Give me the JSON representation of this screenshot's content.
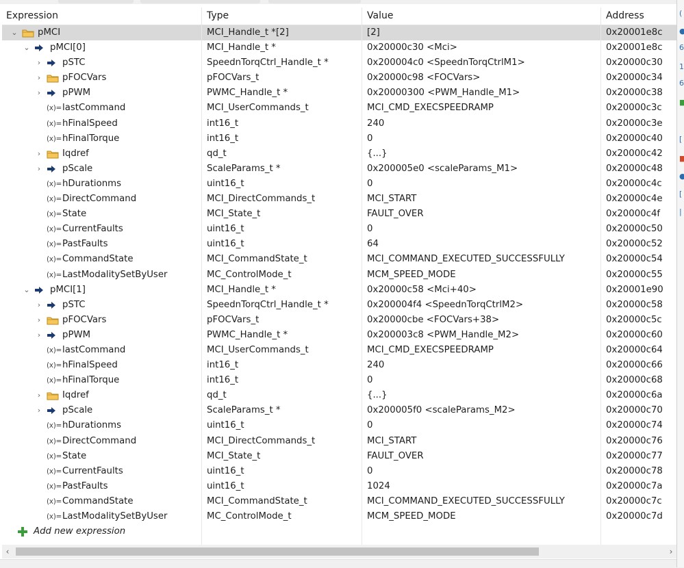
{
  "columns": {
    "expression": "Expression",
    "type": "Type",
    "value": "Value",
    "address": "Address"
  },
  "rows": [
    {
      "name": "pMCI",
      "type": "MCI_Handle_t *[2]",
      "value": "[2]",
      "addr": "0x20001e8c",
      "icon": "folder-struct-icon",
      "level": 0,
      "chevron": "expanded",
      "selected": true
    },
    {
      "name": "pMCI[0]",
      "type": "MCI_Handle_t *",
      "value": "0x20000c30 <Mci>",
      "addr": "0x20001e8c",
      "icon": "pointer-arrow-icon",
      "level": 1,
      "chevron": "expanded"
    },
    {
      "name": "pSTC",
      "type": "SpeednTorqCtrl_Handle_t *",
      "value": "0x200004c0 <SpeednTorqCtrlM1>",
      "addr": "0x20000c30",
      "icon": "pointer-arrow-icon",
      "level": 2,
      "chevron": "collapsed"
    },
    {
      "name": "pFOCVars",
      "type": "pFOCVars_t",
      "value": "0x20000c98 <FOCVars>",
      "addr": "0x20000c34",
      "icon": "folder-struct-icon",
      "level": 2,
      "chevron": "collapsed"
    },
    {
      "name": "pPWM",
      "type": "PWMC_Handle_t *",
      "value": "0x20000300 <PWM_Handle_M1>",
      "addr": "0x20000c38",
      "icon": "pointer-arrow-icon",
      "level": 2,
      "chevron": "collapsed"
    },
    {
      "name": "lastCommand",
      "type": "MCI_UserCommands_t",
      "value": "MCI_CMD_EXECSPEEDRAMP",
      "addr": "0x20000c3c",
      "icon": "variable-icon",
      "level": 2,
      "chevron": "none"
    },
    {
      "name": "hFinalSpeed",
      "type": "int16_t",
      "value": "240",
      "addr": "0x20000c3e",
      "icon": "variable-icon",
      "level": 2,
      "chevron": "none"
    },
    {
      "name": "hFinalTorque",
      "type": "int16_t",
      "value": "0",
      "addr": "0x20000c40",
      "icon": "variable-icon",
      "level": 2,
      "chevron": "none"
    },
    {
      "name": "Iqdref",
      "type": "qd_t",
      "value": "{...}",
      "addr": "0x20000c42",
      "icon": "folder-struct-icon",
      "level": 2,
      "chevron": "collapsed"
    },
    {
      "name": "pScale",
      "type": "ScaleParams_t *",
      "value": "0x200005e0 <scaleParams_M1>",
      "addr": "0x20000c48",
      "icon": "pointer-arrow-icon",
      "level": 2,
      "chevron": "collapsed"
    },
    {
      "name": "hDurationms",
      "type": "uint16_t",
      "value": "0",
      "addr": "0x20000c4c",
      "icon": "variable-icon",
      "level": 2,
      "chevron": "none"
    },
    {
      "name": "DirectCommand",
      "type": "MCI_DirectCommands_t",
      "value": "MCI_START",
      "addr": "0x20000c4e",
      "icon": "variable-icon",
      "level": 2,
      "chevron": "none"
    },
    {
      "name": "State",
      "type": "MCI_State_t",
      "value": "FAULT_OVER",
      "addr": "0x20000c4f",
      "icon": "variable-icon",
      "level": 2,
      "chevron": "none"
    },
    {
      "name": "CurrentFaults",
      "type": "uint16_t",
      "value": "0",
      "addr": "0x20000c50",
      "icon": "variable-icon",
      "level": 2,
      "chevron": "none"
    },
    {
      "name": "PastFaults",
      "type": "uint16_t",
      "value": "64",
      "addr": "0x20000c52",
      "icon": "variable-icon",
      "level": 2,
      "chevron": "none"
    },
    {
      "name": "CommandState",
      "type": "MCI_CommandState_t",
      "value": "MCI_COMMAND_EXECUTED_SUCCESSFULLY",
      "addr": "0x20000c54",
      "icon": "variable-icon",
      "level": 2,
      "chevron": "none"
    },
    {
      "name": "LastModalitySetByUser",
      "type": "MC_ControlMode_t",
      "value": "MCM_SPEED_MODE",
      "addr": "0x20000c55",
      "icon": "variable-icon",
      "level": 2,
      "chevron": "none"
    },
    {
      "name": "pMCI[1]",
      "type": "MCI_Handle_t *",
      "value": "0x20000c58 <Mci+40>",
      "addr": "0x20001e90",
      "icon": "pointer-arrow-icon",
      "level": 1,
      "chevron": "expanded"
    },
    {
      "name": "pSTC",
      "type": "SpeednTorqCtrl_Handle_t *",
      "value": "0x200004f4 <SpeednTorqCtrlM2>",
      "addr": "0x20000c58",
      "icon": "pointer-arrow-icon",
      "level": 2,
      "chevron": "collapsed"
    },
    {
      "name": "pFOCVars",
      "type": "pFOCVars_t",
      "value": "0x20000cbe <FOCVars+38>",
      "addr": "0x20000c5c",
      "icon": "folder-struct-icon",
      "level": 2,
      "chevron": "collapsed"
    },
    {
      "name": "pPWM",
      "type": "PWMC_Handle_t *",
      "value": "0x200003c8 <PWM_Handle_M2>",
      "addr": "0x20000c60",
      "icon": "pointer-arrow-icon",
      "level": 2,
      "chevron": "collapsed"
    },
    {
      "name": "lastCommand",
      "type": "MCI_UserCommands_t",
      "value": "MCI_CMD_EXECSPEEDRAMP",
      "addr": "0x20000c64",
      "icon": "variable-icon",
      "level": 2,
      "chevron": "none"
    },
    {
      "name": "hFinalSpeed",
      "type": "int16_t",
      "value": "240",
      "addr": "0x20000c66",
      "icon": "variable-icon",
      "level": 2,
      "chevron": "none"
    },
    {
      "name": "hFinalTorque",
      "type": "int16_t",
      "value": "0",
      "addr": "0x20000c68",
      "icon": "variable-icon",
      "level": 2,
      "chevron": "none"
    },
    {
      "name": "Iqdref",
      "type": "qd_t",
      "value": "{...}",
      "addr": "0x20000c6a",
      "icon": "folder-struct-icon",
      "level": 2,
      "chevron": "collapsed"
    },
    {
      "name": "pScale",
      "type": "ScaleParams_t *",
      "value": "0x200005f0 <scaleParams_M2>",
      "addr": "0x20000c70",
      "icon": "pointer-arrow-icon",
      "level": 2,
      "chevron": "collapsed"
    },
    {
      "name": "hDurationms",
      "type": "uint16_t",
      "value": "0",
      "addr": "0x20000c74",
      "icon": "variable-icon",
      "level": 2,
      "chevron": "none"
    },
    {
      "name": "DirectCommand",
      "type": "MCI_DirectCommands_t",
      "value": "MCI_START",
      "addr": "0x20000c76",
      "icon": "variable-icon",
      "level": 2,
      "chevron": "none"
    },
    {
      "name": "State",
      "type": "MCI_State_t",
      "value": "FAULT_OVER",
      "addr": "0x20000c77",
      "icon": "variable-icon",
      "level": 2,
      "chevron": "none"
    },
    {
      "name": "CurrentFaults",
      "type": "uint16_t",
      "value": "0",
      "addr": "0x20000c78",
      "icon": "variable-icon",
      "level": 2,
      "chevron": "none"
    },
    {
      "name": "PastFaults",
      "type": "uint16_t",
      "value": "1024",
      "addr": "0x20000c7a",
      "icon": "variable-icon",
      "level": 2,
      "chevron": "none"
    },
    {
      "name": "CommandState",
      "type": "MCI_CommandState_t",
      "value": "MCI_COMMAND_EXECUTED_SUCCESSFULLY",
      "addr": "0x20000c7c",
      "icon": "variable-icon",
      "level": 2,
      "chevron": "none"
    },
    {
      "name": "LastModalitySetByUser",
      "type": "MC_ControlMode_t",
      "value": "MCM_SPEED_MODE",
      "addr": "0x20000c7d",
      "icon": "variable-icon",
      "level": 2,
      "chevron": "none"
    }
  ],
  "add_expression": {
    "label": "Add new expression",
    "icon": "add-plus-icon"
  },
  "icon_glyphs": {
    "variable-icon": "(x)="
  },
  "colors": {
    "selected_row": "#d9d9d9",
    "folder_fill": "#f7c65a",
    "folder_stroke": "#b98a1e",
    "pointer_arrow": "#1b3b6f",
    "add_plus": "#3a9e3a",
    "grid_line": "#e8e8e8"
  }
}
